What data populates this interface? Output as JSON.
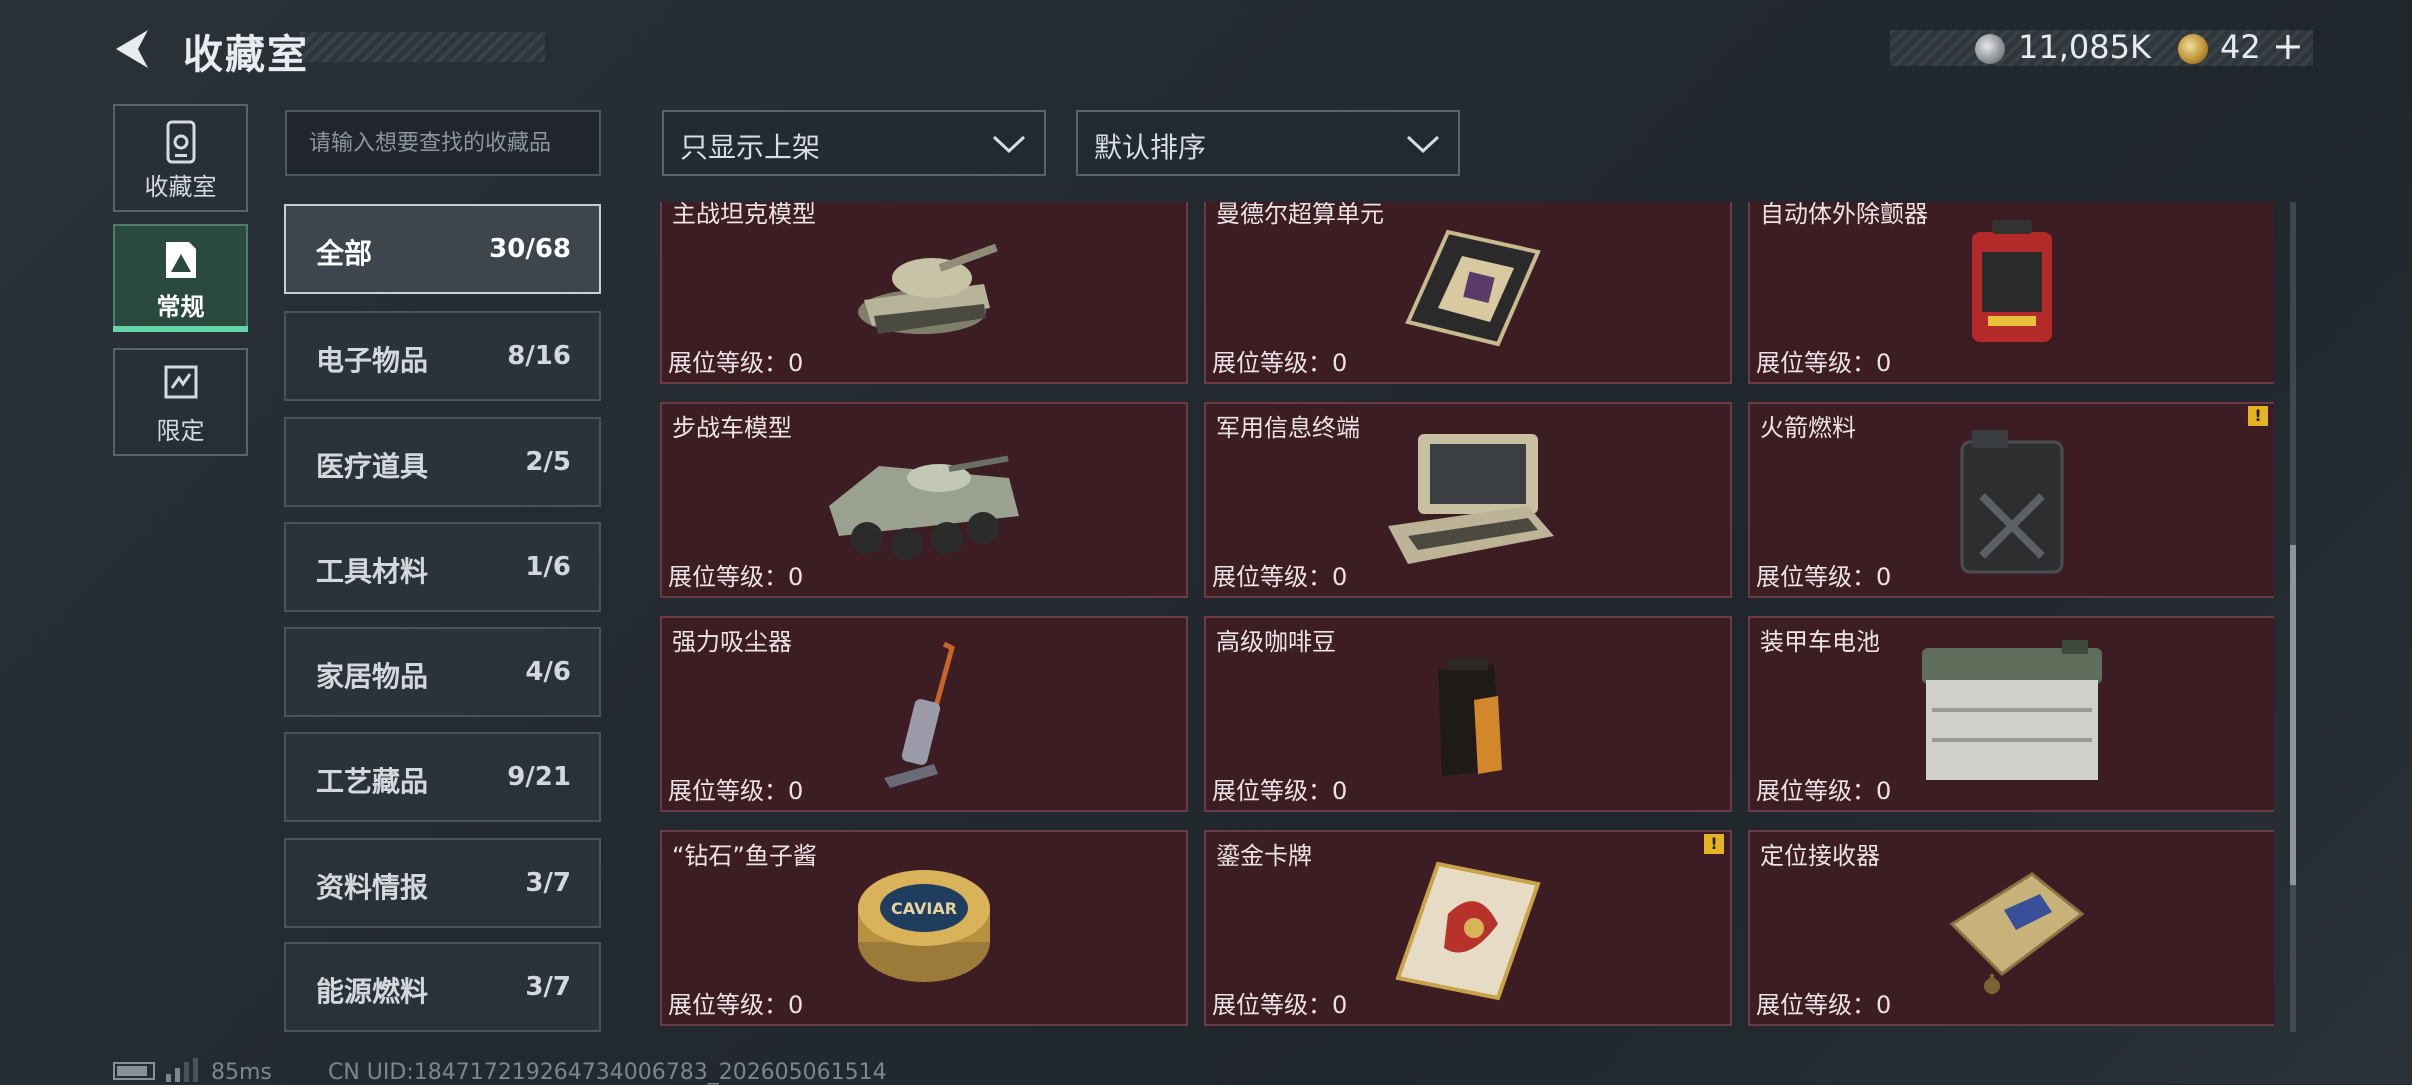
{
  "header": {
    "title": "收藏室",
    "money": "11,085K",
    "tokens": "42",
    "plus": "+"
  },
  "nav": [
    {
      "label": "收藏室",
      "icon": "collection-room-icon"
    },
    {
      "label": "常规",
      "icon": "regular-icon",
      "active": true
    },
    {
      "label": "限定",
      "icon": "limited-icon"
    }
  ],
  "search": {
    "placeholder": "请输入想要查找的收藏品"
  },
  "filters": {
    "display": "只显示上架",
    "sort": "默认排序"
  },
  "categories": [
    {
      "name": "全部",
      "count": "30/68"
    },
    {
      "name": "电子物品",
      "count": "8/16"
    },
    {
      "name": "医疗道具",
      "count": "2/5"
    },
    {
      "name": "工具材料",
      "count": "1/6"
    },
    {
      "name": "家居物品",
      "count": "4/6"
    },
    {
      "name": "工艺藏品",
      "count": "9/21"
    },
    {
      "name": "资料情报",
      "count": "3/7"
    },
    {
      "name": "能源燃料",
      "count": "3/7"
    }
  ],
  "items": [
    {
      "name": "主战坦克模型",
      "level": "展位等级：0",
      "icon": "tank-model-icon"
    },
    {
      "name": "曼德尔超算单元",
      "level": "展位等级：0",
      "icon": "supercomputer-unit-icon"
    },
    {
      "name": "自动体外除颤器",
      "level": "展位等级：0",
      "icon": "defibrillator-icon"
    },
    {
      "name": "步战车模型",
      "level": "展位等级：0",
      "icon": "ifv-model-icon"
    },
    {
      "name": "军用信息终端",
      "level": "展位等级：0",
      "icon": "military-terminal-icon"
    },
    {
      "name": "火箭燃料",
      "level": "展位等级：0",
      "icon": "rocket-fuel-icon",
      "warn": "!"
    },
    {
      "name": "强力吸尘器",
      "level": "展位等级：0",
      "icon": "vacuum-cleaner-icon"
    },
    {
      "name": "高级咖啡豆",
      "level": "展位等级：0",
      "icon": "coffee-beans-icon"
    },
    {
      "name": "装甲车电池",
      "level": "展位等级：0",
      "icon": "vehicle-battery-icon"
    },
    {
      "name": "“钻石”鱼子酱",
      "level": "展位等级：0",
      "icon": "caviar-tin-icon",
      "art_text": "CAVIAR"
    },
    {
      "name": "鎏金卡牌",
      "level": "展位等级：0",
      "icon": "gilded-card-icon",
      "warn": "!"
    },
    {
      "name": "定位接收器",
      "level": "展位等级：0",
      "icon": "gps-receiver-icon"
    }
  ],
  "footer": {
    "ping": "85ms",
    "uid": "CN UID:1847172192647340067​83_202605061514"
  },
  "colors": {
    "card_bg": "#3c1d23",
    "accent": "#62d6a6",
    "warn": "#e6b422"
  }
}
